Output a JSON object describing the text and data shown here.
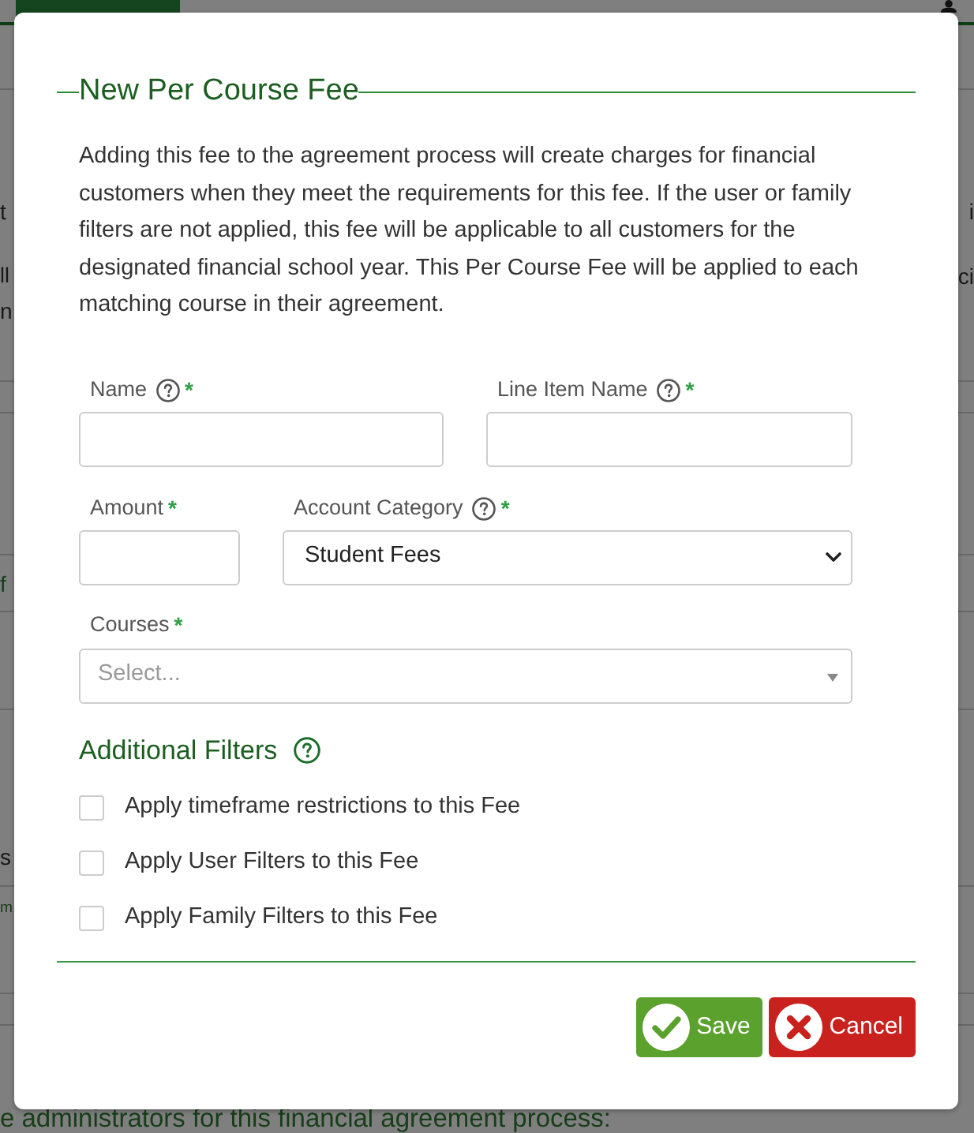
{
  "page": {
    "nav_bar": {
      "tabs": [
        {
          "selected": true
        }
      ]
    },
    "edge_lines": [
      {
        "left": {
          "text": "t",
          "kind": "text"
        },
        "right": {
          "text": "i",
          "kind": "text"
        }
      },
      {
        "left": {
          "text": "ll",
          "kind": "text"
        },
        "right": {
          "text": "ci",
          "kind": "text"
        }
      },
      {
        "left": {
          "text": "n",
          "kind": "text"
        }
      },
      {
        "left": {
          "text": "f",
          "kind": "link"
        }
      },
      {
        "left": {
          "text": "s",
          "kind": "text"
        }
      },
      {
        "left": {
          "text": "m",
          "kind": "link"
        }
      }
    ],
    "footer_text": "e administrators for this financial agreement process:"
  },
  "dialog": {
    "title": "New Per Course Fee",
    "description": "Adding this fee to the agreement process will create charges for financial customers when they meet the requirements for this fee. If the user or family filters are not applied, this fee will be applicable to all customers for the designated financial school year. This Per Course Fee will be applied to each matching course in their agreement.",
    "field_rows": [
      [
        {
          "kind": "text",
          "label": "Name",
          "help_icon": true,
          "required_mark": "*"
        },
        {
          "kind": "text",
          "label": "Line Item Name",
          "help_icon": true,
          "required_mark": "*"
        }
      ],
      [
        {
          "kind": "text",
          "label": "Amount",
          "required_mark": "*"
        },
        {
          "kind": "select",
          "label": "Account Category",
          "help_icon": true,
          "required_mark": "*",
          "value": "Student Fees"
        }
      ],
      [
        {
          "kind": "multiselect",
          "label": "Courses",
          "required_mark": "*",
          "placeholder": "Select..."
        }
      ]
    ],
    "filters_heading": {
      "text": "Additional Filters",
      "help_icon": true
    },
    "filters": [
      {
        "label": "Apply timeframe restrictions to this Fee",
        "checked": false
      },
      {
        "label": "Apply User Filters to this Fee",
        "checked": false
      },
      {
        "label": "Apply Family Filters to this Fee",
        "checked": false
      }
    ],
    "buttons": [
      {
        "kind": "save",
        "label": "Save"
      },
      {
        "kind": "cancel",
        "label": "Cancel"
      }
    ]
  }
}
